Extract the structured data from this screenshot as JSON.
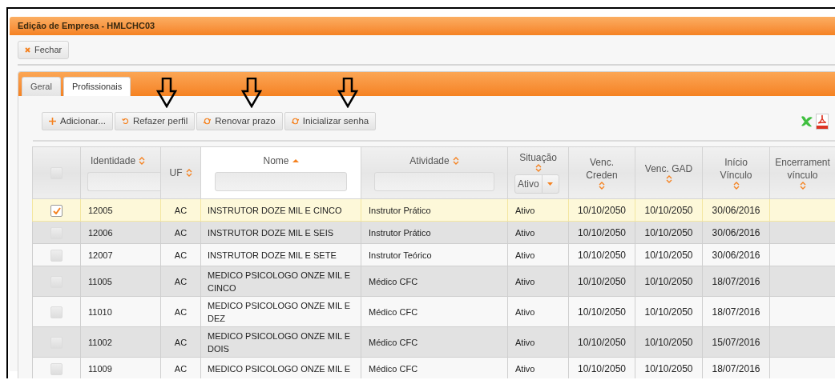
{
  "window": {
    "title": "Edição de Empresa - HMLCHC03"
  },
  "close_button": {
    "label": "Fechar"
  },
  "tabs": [
    {
      "label": "Geral",
      "selected": false
    },
    {
      "label": "Profissionais",
      "selected": true
    }
  ],
  "toolbar": [
    {
      "label": "Adicionar...",
      "kind": "add"
    },
    {
      "label": "Refazer perfil",
      "kind": "redo"
    },
    {
      "label": "Renovar prazo",
      "kind": "renew"
    },
    {
      "label": "Inicializar senha",
      "kind": "renew"
    }
  ],
  "table": {
    "select_all_checked": false,
    "columns": [
      {
        "label": "Identidade",
        "sorted": false,
        "filter_field": true
      },
      {
        "label": "UF",
        "sorted": false,
        "filter_field": false
      },
      {
        "label": "Nome",
        "sorted": true,
        "filter_field": true
      },
      {
        "label": "Atividade",
        "sorted": false,
        "filter_field": true
      },
      {
        "label": "Situação",
        "sorted": false,
        "filter_field": false,
        "filter_value": "Ativo"
      },
      {
        "label": "Venc. Creden",
        "sorted": false,
        "filter_field": false
      },
      {
        "label": "Venc. GAD",
        "sorted": false,
        "filter_field": false
      },
      {
        "label": "Início Vínculo",
        "sorted": false,
        "filter_field": false
      },
      {
        "label": "Encerrament vínculo",
        "sorted": false,
        "filter_field": false
      }
    ],
    "rows": [
      {
        "selected": true,
        "checked": true,
        "cells": [
          "12005",
          "AC",
          "INSTRUTOR DOZE MIL E CINCO",
          "Instrutor Prático",
          "Ativo",
          "10/10/2050",
          "10/10/2050",
          "30/06/2016"
        ]
      },
      {
        "selected": false,
        "checked": false,
        "cells": [
          "12006",
          "AC",
          "INSTRUTOR DOZE MIL E SEIS",
          "Instrutor Prático",
          "Ativo",
          "10/10/2050",
          "10/10/2050",
          "30/06/2016"
        ]
      },
      {
        "selected": false,
        "checked": false,
        "cells": [
          "12007",
          "AC",
          "INSTRUTOR DOZE MIL E SETE",
          "Instrutor Teórico",
          "Ativo",
          "10/10/2050",
          "10/10/2050",
          "30/06/2016"
        ]
      },
      {
        "selected": false,
        "checked": false,
        "cells": [
          "11005",
          "AC",
          "MEDICO PSICOLOGO ONZE MIL E CINCO",
          "Médico CFC",
          "Ativo",
          "10/10/2050",
          "10/10/2050",
          "18/07/2016"
        ]
      },
      {
        "selected": false,
        "checked": false,
        "cells": [
          "11010",
          "AC",
          "MEDICO PSICOLOGO ONZE MIL E DEZ",
          "Médico CFC",
          "Ativo",
          "10/10/2050",
          "10/10/2050",
          "18/07/2016"
        ]
      },
      {
        "selected": false,
        "checked": false,
        "cells": [
          "11002",
          "AC",
          "MEDICO PSICOLOGO ONZE MIL E DOIS",
          "Médico CFC",
          "Ativo",
          "10/10/2050",
          "10/10/2050",
          "15/07/2016"
        ]
      },
      {
        "selected": false,
        "checked": false,
        "cells": [
          "11009",
          "AC",
          "MEDICO PSICOLOGO ONZE MIL E",
          "Médico CFC",
          "Ativo",
          "10/10/2050",
          "10/10/2050",
          "18/07/2016"
        ]
      }
    ]
  }
}
